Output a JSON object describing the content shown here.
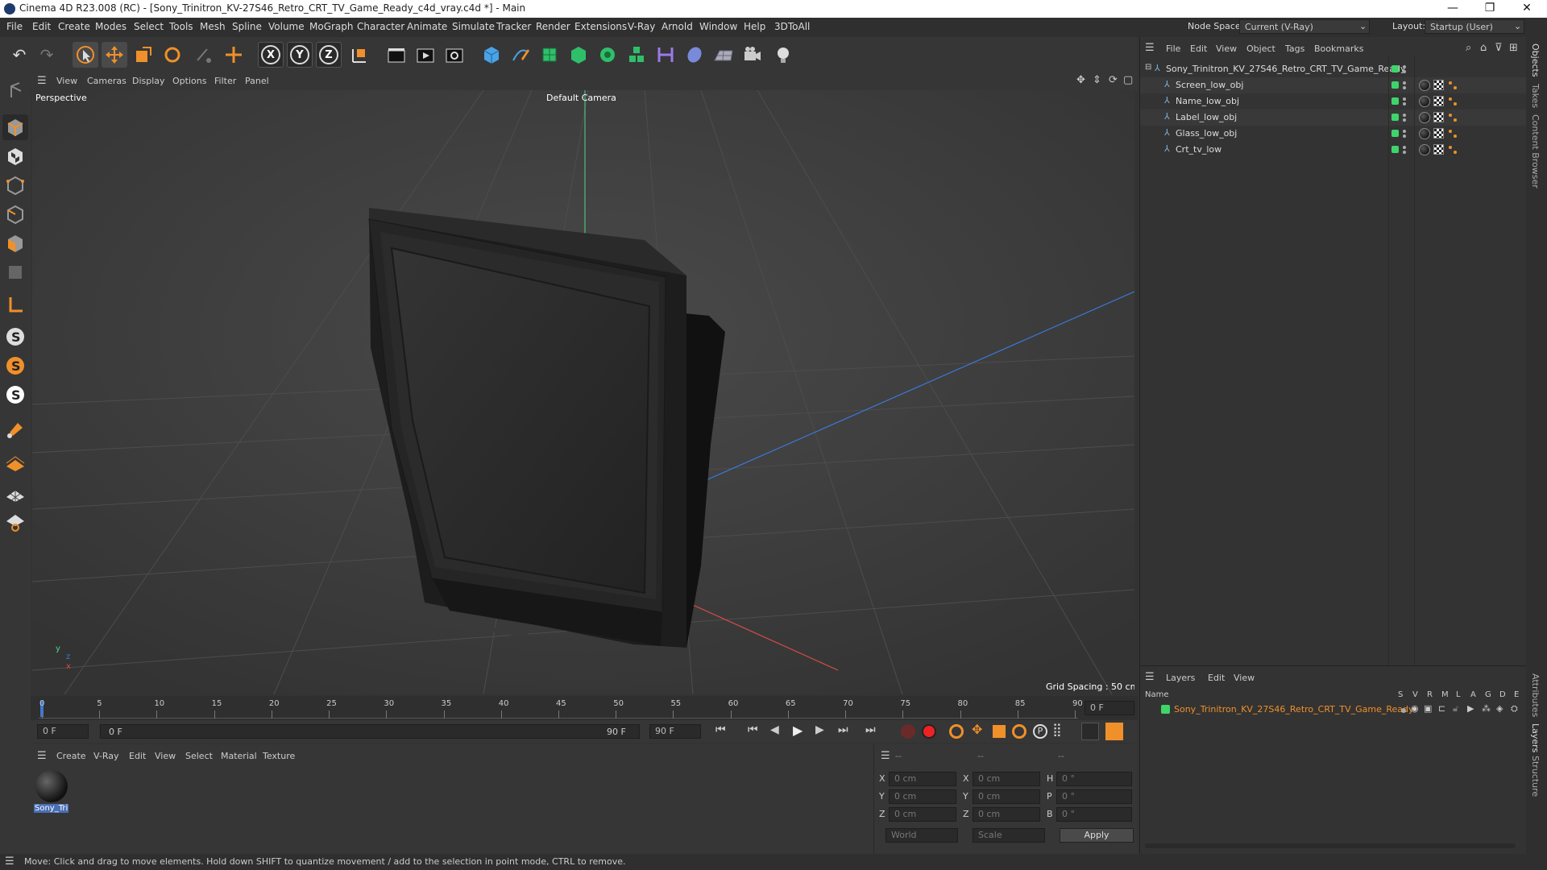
{
  "window": {
    "title": "Cinema 4D R23.008 (RC) - [Sony_Trinitron_KV-27S46_Retro_CRT_TV_Game_Ready_c4d_vray.c4d *] - Main",
    "min": "—",
    "max": "❐",
    "close": "✕"
  },
  "menubar": {
    "items": [
      "File",
      "Edit",
      "Create",
      "Modes",
      "Select",
      "Tools",
      "Mesh",
      "Spline",
      "Volume",
      "MoGraph",
      "Character",
      "Animate",
      "Simulate",
      "Tracker",
      "Render",
      "Extensions",
      "V-Ray",
      "Arnold",
      "Window",
      "Help",
      "3DToAll"
    ],
    "node_space_label": "Node Space:",
    "node_space_value": "Current (V-Ray)",
    "layout_label": "Layout:",
    "layout_value": "Startup (User)"
  },
  "toolbar": {
    "axis_x": "X",
    "axis_y": "Y",
    "axis_z": "Z"
  },
  "viewport": {
    "menu": [
      "View",
      "Cameras",
      "Display",
      "Options",
      "Filter",
      "Panel"
    ],
    "projection": "Perspective",
    "camera": "Default Camera",
    "grid_spacing": "Grid Spacing : 50 cm",
    "axis_y": "y",
    "axis_z": "z",
    "axis_x": "x"
  },
  "timeline": {
    "ticks": [
      "0",
      "5",
      "10",
      "15",
      "20",
      "25",
      "30",
      "35",
      "40",
      "45",
      "50",
      "55",
      "60",
      "65",
      "70",
      "75",
      "80",
      "85",
      "90"
    ],
    "current_frame_right": "0 F"
  },
  "transport": {
    "start_field": "0 F",
    "range_start": "0 F",
    "range_end": "90 F",
    "end_field": "90 F"
  },
  "material_panel": {
    "menu": [
      "Create",
      "V-Ray",
      "Edit",
      "View",
      "Select",
      "Material",
      "Texture"
    ],
    "material_name": "Sony_Tri"
  },
  "coord_panel": {
    "headers": [
      "--",
      "--",
      "--"
    ],
    "rows": [
      {
        "a_label": "X",
        "a_val": "0 cm",
        "b_label": "X",
        "b_val": "0 cm",
        "c_label": "H",
        "c_val": "0 °"
      },
      {
        "a_label": "Y",
        "a_val": "0 cm",
        "b_label": "Y",
        "b_val": "0 cm",
        "c_label": "P",
        "c_val": "0 °"
      },
      {
        "a_label": "Z",
        "a_val": "0 cm",
        "b_label": "Z",
        "b_val": "0 cm",
        "c_label": "B",
        "c_val": "0 °"
      }
    ],
    "mode1": "World",
    "mode2": "Scale",
    "apply": "Apply"
  },
  "object_manager": {
    "menu": [
      "File",
      "Edit",
      "View",
      "Object",
      "Tags",
      "Bookmarks"
    ],
    "root": "Sony_Trinitron_KV_27S46_Retro_CRT_TV_Game_Ready",
    "children": [
      "Screen_low_obj",
      "Name_low_obj",
      "Label_low_obj",
      "Glass_low_obj",
      "Crt_tv_low"
    ]
  },
  "layers": {
    "menu": [
      "Layers",
      "Edit",
      "View"
    ],
    "name_header": "Name",
    "col_headers": [
      "S",
      "V",
      "R",
      "M",
      "L",
      "A",
      "G",
      "D",
      "E"
    ],
    "layer_name": "Sony_Trinitron_KV_27S46_Retro_CRT_TV_Game_Ready"
  },
  "side_tabs": [
    "Objects",
    "Takes",
    "Content Browser",
    "Attributes",
    "Layers",
    "Structure"
  ],
  "status": "Move: Click and drag to move elements. Hold down SHIFT to quantize movement / add to the selection in point mode, CTRL to remove.",
  "colors": {
    "accent_orange": "#f0902a",
    "layer_green": "#3fd46a",
    "axis_blue": "#3a78d8",
    "axis_red": "#d84a4a",
    "axis_green": "#4ad88a"
  }
}
